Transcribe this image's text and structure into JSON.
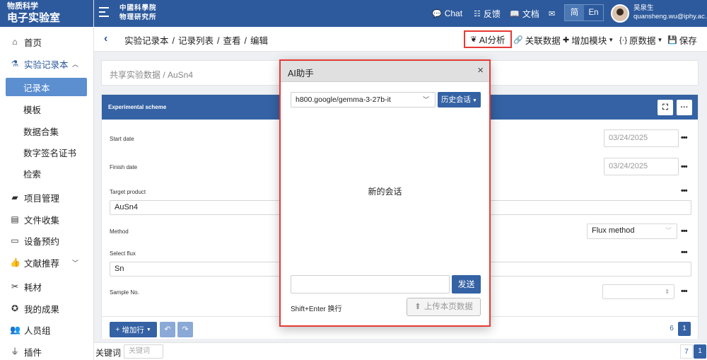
{
  "brand": {
    "line1": "物质科学",
    "line2": "电子实验室"
  },
  "institute": {
    "line1": "中國科學院",
    "line2": "物理研究所"
  },
  "sidebar": {
    "items": [
      {
        "label": "首页",
        "icon": "home-icon"
      },
      {
        "label": "实验记录本",
        "icon": "flask-icon"
      },
      {
        "label": "记录本"
      },
      {
        "label": "模板"
      },
      {
        "label": "数据合集"
      },
      {
        "label": "数字签名证书"
      },
      {
        "label": "检索"
      },
      {
        "label": "项目管理",
        "icon": "folder-icon"
      },
      {
        "label": "文件收集",
        "icon": "collect-icon"
      },
      {
        "label": "设备预约",
        "icon": "device-icon"
      },
      {
        "label": "文献推荐",
        "icon": "thumbs-up-icon"
      },
      {
        "label": "耗材",
        "icon": "tools-icon"
      },
      {
        "label": "我的成果",
        "icon": "award-icon"
      },
      {
        "label": "人员组",
        "icon": "users-icon"
      },
      {
        "label": "插件",
        "icon": "plug-icon"
      }
    ]
  },
  "topbar": {
    "chat": "Chat",
    "feedback": "反馈",
    "docs": "文档",
    "lang_cn": "简",
    "lang_en": "En",
    "user_name": "吴泉生",
    "user_email": "quansheng.wu@iphy.ac.cn"
  },
  "toolbar": {
    "crumbs": [
      "实验记录本",
      "记录列表",
      "查看",
      "编辑"
    ],
    "ai": "AI分析",
    "linked": "关联数据",
    "add_module": "增加模块",
    "raw": "原数据",
    "save": "保存"
  },
  "path": "共享实验数据 / AuSn4",
  "card": {
    "title": "Experimental scheme",
    "start_date_label": "Start date",
    "start_date": {
      "m": "03",
      "d": "24",
      "y": "2025"
    },
    "finish_date_label": "Finish date",
    "finish_date": {
      "m": "03",
      "d": "24",
      "y": "2025"
    },
    "target_label": "Target product",
    "target_value": "AuSn4",
    "method_label": "Method",
    "method_value": "Flux method",
    "flux_label": "Select flux",
    "flux_value": "Sn",
    "sample_label": "Sample No.",
    "add_row": "增加行",
    "page_a": "6",
    "page_b": "1"
  },
  "keyword": {
    "label": "关键词",
    "placeholder": "关键词",
    "page_a": "7",
    "page_b": "1"
  },
  "modal": {
    "title": "AI助手",
    "model": "h800.google/gemma-3-27b-it",
    "history": "历史会话",
    "new_chat": "新的会话",
    "send": "发送",
    "hint": "Shift+Enter 换行",
    "upload": "上传本页数据"
  },
  "colors": {
    "primary": "#2d5a9c",
    "button": "#3462a4",
    "highlight": "#e53935"
  }
}
